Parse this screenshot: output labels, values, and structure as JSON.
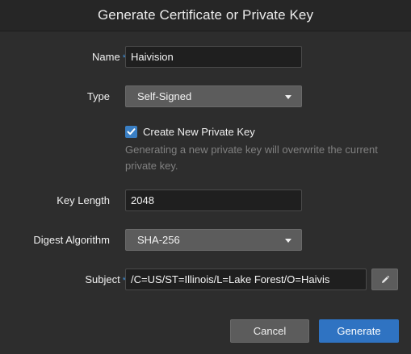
{
  "dialog": {
    "title": "Generate Certificate or Private Key"
  },
  "form": {
    "name": {
      "label": "Name",
      "required_mark": "*",
      "value": "Haivision"
    },
    "type": {
      "label": "Type",
      "value": "Self-Signed"
    },
    "create_key": {
      "checked": true,
      "label": "Create New Private Key",
      "help": "Generating a new private key will overwrite the current private key."
    },
    "key_length": {
      "label": "Key Length",
      "value": "2048"
    },
    "digest": {
      "label": "Digest Algorithm",
      "value": "SHA-256"
    },
    "subject": {
      "label": "Subject",
      "required_mark": "*",
      "value": "/C=US/ST=Illinois/L=Lake Forest/O=Haivis"
    }
  },
  "buttons": {
    "cancel": "Cancel",
    "generate": "Generate"
  },
  "icons": {
    "edit": "pencil-icon",
    "checkbox": "checkmark-icon",
    "dropdown": "caret-down-icon"
  },
  "colors": {
    "accent": "#2f73c2",
    "required": "#3f8fd8"
  }
}
